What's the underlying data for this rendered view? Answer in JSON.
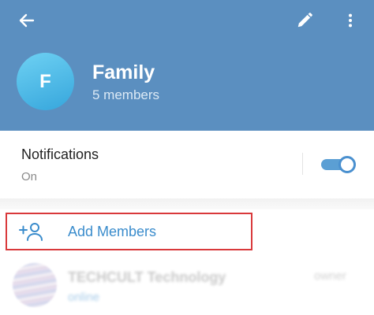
{
  "header": {
    "back_icon": "back-arrow-icon",
    "edit_icon": "pencil-icon",
    "more_icon": "more-vertical-icon",
    "avatar_letter": "F",
    "title": "Family",
    "subtitle": "5 members",
    "background_color": "#5b8fc0"
  },
  "notifications": {
    "title": "Notifications",
    "status": "On",
    "enabled": true,
    "toggle_color": "#4a90cf"
  },
  "add_members": {
    "icon": "add-person-icon",
    "label": "Add Members",
    "label_color": "#3a8ccc",
    "highlight_color": "#d9393b"
  },
  "members": [
    {
      "name": "TECHCULT Technology",
      "status": "online",
      "role": "owner"
    }
  ]
}
